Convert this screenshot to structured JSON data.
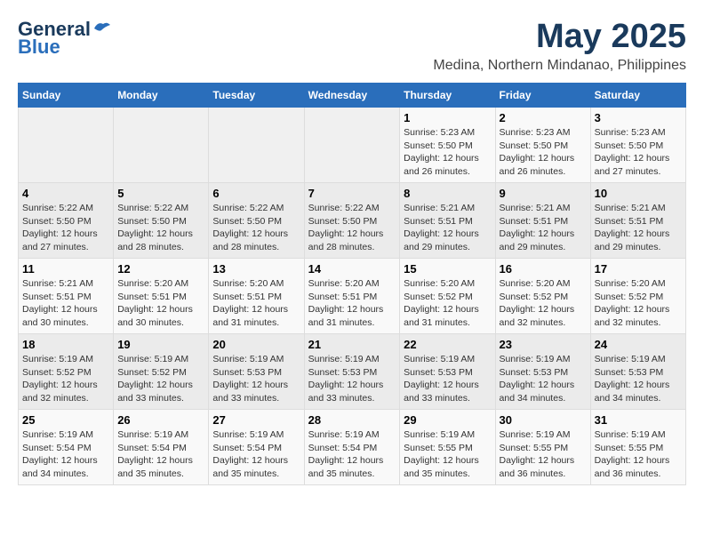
{
  "logo": {
    "line1": "General",
    "line2": "Blue"
  },
  "title": "May 2025",
  "subtitle": "Medina, Northern Mindanao, Philippines",
  "days_of_week": [
    "Sunday",
    "Monday",
    "Tuesday",
    "Wednesday",
    "Thursday",
    "Friday",
    "Saturday"
  ],
  "weeks": [
    [
      {
        "day": "",
        "info": ""
      },
      {
        "day": "",
        "info": ""
      },
      {
        "day": "",
        "info": ""
      },
      {
        "day": "",
        "info": ""
      },
      {
        "day": "1",
        "info": "Sunrise: 5:23 AM\nSunset: 5:50 PM\nDaylight: 12 hours\nand 26 minutes."
      },
      {
        "day": "2",
        "info": "Sunrise: 5:23 AM\nSunset: 5:50 PM\nDaylight: 12 hours\nand 26 minutes."
      },
      {
        "day": "3",
        "info": "Sunrise: 5:23 AM\nSunset: 5:50 PM\nDaylight: 12 hours\nand 27 minutes."
      }
    ],
    [
      {
        "day": "4",
        "info": "Sunrise: 5:22 AM\nSunset: 5:50 PM\nDaylight: 12 hours\nand 27 minutes."
      },
      {
        "day": "5",
        "info": "Sunrise: 5:22 AM\nSunset: 5:50 PM\nDaylight: 12 hours\nand 28 minutes."
      },
      {
        "day": "6",
        "info": "Sunrise: 5:22 AM\nSunset: 5:50 PM\nDaylight: 12 hours\nand 28 minutes."
      },
      {
        "day": "7",
        "info": "Sunrise: 5:22 AM\nSunset: 5:50 PM\nDaylight: 12 hours\nand 28 minutes."
      },
      {
        "day": "8",
        "info": "Sunrise: 5:21 AM\nSunset: 5:51 PM\nDaylight: 12 hours\nand 29 minutes."
      },
      {
        "day": "9",
        "info": "Sunrise: 5:21 AM\nSunset: 5:51 PM\nDaylight: 12 hours\nand 29 minutes."
      },
      {
        "day": "10",
        "info": "Sunrise: 5:21 AM\nSunset: 5:51 PM\nDaylight: 12 hours\nand 29 minutes."
      }
    ],
    [
      {
        "day": "11",
        "info": "Sunrise: 5:21 AM\nSunset: 5:51 PM\nDaylight: 12 hours\nand 30 minutes."
      },
      {
        "day": "12",
        "info": "Sunrise: 5:20 AM\nSunset: 5:51 PM\nDaylight: 12 hours\nand 30 minutes."
      },
      {
        "day": "13",
        "info": "Sunrise: 5:20 AM\nSunset: 5:51 PM\nDaylight: 12 hours\nand 31 minutes."
      },
      {
        "day": "14",
        "info": "Sunrise: 5:20 AM\nSunset: 5:51 PM\nDaylight: 12 hours\nand 31 minutes."
      },
      {
        "day": "15",
        "info": "Sunrise: 5:20 AM\nSunset: 5:52 PM\nDaylight: 12 hours\nand 31 minutes."
      },
      {
        "day": "16",
        "info": "Sunrise: 5:20 AM\nSunset: 5:52 PM\nDaylight: 12 hours\nand 32 minutes."
      },
      {
        "day": "17",
        "info": "Sunrise: 5:20 AM\nSunset: 5:52 PM\nDaylight: 12 hours\nand 32 minutes."
      }
    ],
    [
      {
        "day": "18",
        "info": "Sunrise: 5:19 AM\nSunset: 5:52 PM\nDaylight: 12 hours\nand 32 minutes."
      },
      {
        "day": "19",
        "info": "Sunrise: 5:19 AM\nSunset: 5:52 PM\nDaylight: 12 hours\nand 33 minutes."
      },
      {
        "day": "20",
        "info": "Sunrise: 5:19 AM\nSunset: 5:53 PM\nDaylight: 12 hours\nand 33 minutes."
      },
      {
        "day": "21",
        "info": "Sunrise: 5:19 AM\nSunset: 5:53 PM\nDaylight: 12 hours\nand 33 minutes."
      },
      {
        "day": "22",
        "info": "Sunrise: 5:19 AM\nSunset: 5:53 PM\nDaylight: 12 hours\nand 33 minutes."
      },
      {
        "day": "23",
        "info": "Sunrise: 5:19 AM\nSunset: 5:53 PM\nDaylight: 12 hours\nand 34 minutes."
      },
      {
        "day": "24",
        "info": "Sunrise: 5:19 AM\nSunset: 5:53 PM\nDaylight: 12 hours\nand 34 minutes."
      }
    ],
    [
      {
        "day": "25",
        "info": "Sunrise: 5:19 AM\nSunset: 5:54 PM\nDaylight: 12 hours\nand 34 minutes."
      },
      {
        "day": "26",
        "info": "Sunrise: 5:19 AM\nSunset: 5:54 PM\nDaylight: 12 hours\nand 35 minutes."
      },
      {
        "day": "27",
        "info": "Sunrise: 5:19 AM\nSunset: 5:54 PM\nDaylight: 12 hours\nand 35 minutes."
      },
      {
        "day": "28",
        "info": "Sunrise: 5:19 AM\nSunset: 5:54 PM\nDaylight: 12 hours\nand 35 minutes."
      },
      {
        "day": "29",
        "info": "Sunrise: 5:19 AM\nSunset: 5:55 PM\nDaylight: 12 hours\nand 35 minutes."
      },
      {
        "day": "30",
        "info": "Sunrise: 5:19 AM\nSunset: 5:55 PM\nDaylight: 12 hours\nand 36 minutes."
      },
      {
        "day": "31",
        "info": "Sunrise: 5:19 AM\nSunset: 5:55 PM\nDaylight: 12 hours\nand 36 minutes."
      }
    ]
  ],
  "colors": {
    "header_bg": "#2a6ebb",
    "header_text": "#ffffff",
    "title_color": "#1a3a5c",
    "row_alt": "#ebebeb"
  }
}
